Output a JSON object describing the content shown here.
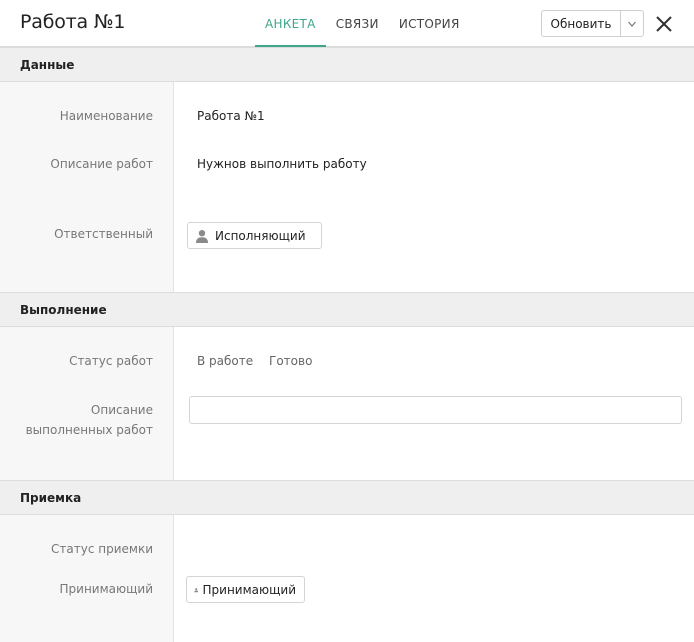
{
  "header": {
    "title": "Работа №1",
    "tabs": [
      {
        "label": "АНКЕТА",
        "active": true
      },
      {
        "label": "СВЯЗИ",
        "active": false
      },
      {
        "label": "ИСТОРИЯ",
        "active": false
      }
    ],
    "refresh_label": "Обновить",
    "dropdown_icon": "chevron-down-icon",
    "close_icon": "close-icon"
  },
  "sections": {
    "data": {
      "title": "Данные",
      "name_label": "Наименование",
      "name_value": "Работа №1",
      "desc_label": "Описание работ",
      "desc_value": "Нужнов выполнить работу",
      "resp_label": "Ответственный",
      "resp_value": "Исполняющий"
    },
    "execution": {
      "title": "Выполнение",
      "status_label": "Статус работ",
      "status_options": [
        "В работе",
        "Готово"
      ],
      "done_desc_label_1": "Описание",
      "done_desc_label_2": "выполненных работ",
      "done_desc_value": ""
    },
    "acceptance": {
      "title": "Приемка",
      "status_label": "Статус приемки",
      "receiver_label": "Принимающий",
      "receiver_value": "Принимающий"
    }
  },
  "colors": {
    "accent": "#3fa58c",
    "section_bg": "#efefef",
    "label_col_bg": "#f7f7f7",
    "label_text": "#777777"
  }
}
